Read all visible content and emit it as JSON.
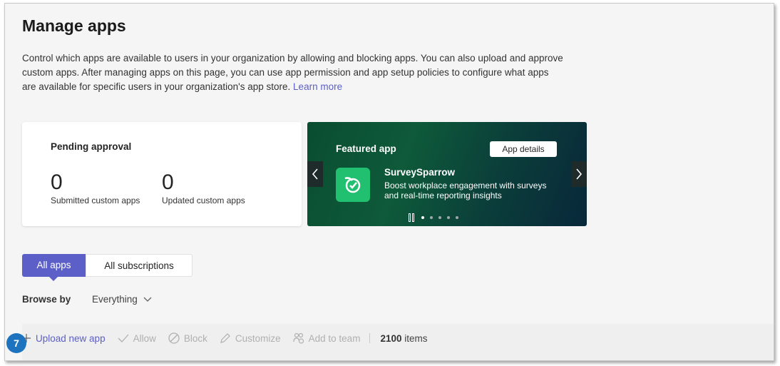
{
  "page": {
    "title": "Manage apps",
    "description": "Control which apps are available to users in your organization by allowing and blocking apps. You can also upload and approve custom apps. After managing apps on this page, you can use app permission and app setup policies to configure what apps are available for specific users in your organization's app store.",
    "learn_more": "Learn more"
  },
  "pending": {
    "title": "Pending approval",
    "submitted_count": "0",
    "submitted_label": "Submitted custom apps",
    "updated_count": "0",
    "updated_label": "Updated custom apps"
  },
  "featured": {
    "label": "Featured app",
    "details_button": "App details",
    "app_name": "SurveySparrow",
    "app_description": "Boost workplace engagement with surveys and real-time reporting insights",
    "app_icon": "survey-bird-icon",
    "accent_color": "#20c070",
    "dots_total": 5,
    "active_dot": 1
  },
  "tabs": [
    {
      "label": "All apps",
      "active": true
    },
    {
      "label": "All subscriptions",
      "active": false
    }
  ],
  "browse": {
    "label": "Browse by",
    "value": "Everything"
  },
  "toolbar": {
    "upload": "Upload new app",
    "allow": "Allow",
    "block": "Block",
    "customize": "Customize",
    "add_to_team": "Add to team",
    "count_value": "2100",
    "count_unit": "items"
  },
  "step_badge": "7",
  "colors": {
    "brand": "#5b5fc7",
    "badge": "#1e73be"
  }
}
